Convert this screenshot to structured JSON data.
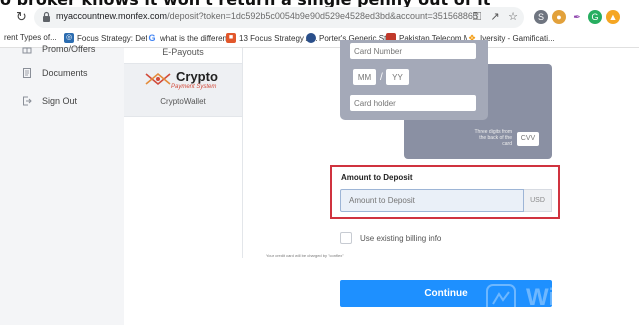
{
  "caption": {
    "text": "o broker knows it won't return a single penny out of it"
  },
  "browser": {
    "url_host": "myaccountnew.monfex.com",
    "url_path": "/deposit?token=1dc592b5c0054b9e90d529e4528ed3bd&account=351568865"
  },
  "bookmarks": [
    {
      "label": "rent Types of...",
      "icon": "generic-icon",
      "color": "#888888"
    },
    {
      "label": "Focus Strategy: Defi...",
      "icon": "target-icon",
      "color": "#2b6cb0"
    },
    {
      "label": "what is the differen...",
      "icon": "google-icon",
      "color": "#4285f4"
    },
    {
      "label": "13 Focus Strategy A...",
      "icon": "bookmark-square-icon",
      "color": "#e2572b"
    },
    {
      "label": "Porter's Generic Str...",
      "icon": "circle-icon",
      "color": "#2a4f8a"
    },
    {
      "label": "Pakistan Telecom M...",
      "icon": "square-icon",
      "color": "#c0392b"
    },
    {
      "label": "Iversity - Gamificati...",
      "icon": "gamepad-icon",
      "color": "#f39c12"
    }
  ],
  "sidebar": {
    "items": [
      {
        "label": "Promo/Offers"
      },
      {
        "label": "Documents"
      },
      {
        "label": "Sign Out"
      }
    ]
  },
  "payment_methods": {
    "epayouts": "E-Payouts",
    "crypto": {
      "name": "Crypto",
      "subtitle": "Payment System",
      "wallet": "CryptoWallet"
    }
  },
  "card_form": {
    "card_number_placeholder": "Card Number",
    "month_placeholder": "MM",
    "year_placeholder": "YY",
    "slash": "/",
    "holder_placeholder": "Card holder",
    "cvv_hint": "Three digits from the back of the card",
    "cvv_placeholder": "CVV"
  },
  "amount": {
    "label": "Amount to Deposit",
    "placeholder": "Amount to Deposit",
    "currency": "USD"
  },
  "billing_label": "Use existing billing info",
  "charge_note": "Your credit card will be charged by \"conflex\"",
  "continue_label": "Continue",
  "watermark": "Wiki",
  "colors": {
    "accent": "#1e90ff",
    "highlight": "#d0333f",
    "card_front": "#a4a9b8",
    "card_back": "#8a90a3"
  }
}
